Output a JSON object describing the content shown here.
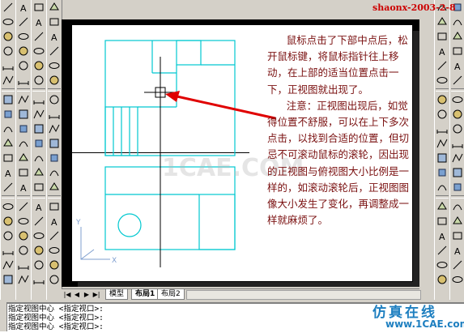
{
  "stamp": "shaonx-2003-2-8",
  "note": {
    "p1": "鼠标点击了下部中点后，松开鼠标键，将鼠标指针往上移动，在上部的适当位置点击一下，正视图就出现了。",
    "p2": "注意：正视图出现后，如觉得位置不舒服，可以在上下多次点击，以找到合适的位置，但切忌不可滚动鼠标的滚轮，因出现的正视图与俯视图大小比例是一样的，如滚动滚轮后，正视图图像大小发生了变化，再调整成一样就麻烦了。"
  },
  "ucs": {
    "x": "X",
    "y": "Y"
  },
  "tabs": {
    "model": "模型",
    "layout1": "布局1",
    "layout2": "布局2"
  },
  "command_lines": [
    "指定视图中心 <指定视口>:",
    "指定视图中心 <指定视口>:",
    "指定视图中心 <指定视口>:"
  ],
  "watermark": "1CAE.COM",
  "brand": {
    "title": "仿真在线",
    "url": "www.1CAE.com"
  },
  "colors": {
    "drawing_line": "#00c8d0",
    "note_text": "#7a1010",
    "arrow": "#e00000",
    "brand": "#1e7fc0"
  },
  "left_toolbar_icons": [
    "line-icon",
    "polyline-icon",
    "rectangle-icon",
    "circle-icon",
    "arc-icon",
    "ellipse-icon",
    "hatch-icon",
    "text-icon",
    "dimension-icon",
    "layer-icon",
    "properties-icon",
    "zoom-icon",
    "pan-icon",
    "3d-box-icon",
    "3d-sphere-icon",
    "3d-cylinder-icon",
    "3d-cone-icon",
    "3d-wedge-icon",
    "3d-torus-icon",
    "render-icon",
    "shade-icon",
    "view-icon"
  ],
  "right_toolbar_icons": [
    "line-icon",
    "construction-line-icon",
    "polyline-icon",
    "polygon-icon",
    "rectangle-icon",
    "arc-icon",
    "circle-icon",
    "revision-cloud-icon",
    "spline-icon",
    "ellipse-icon",
    "ellipse-arc-icon",
    "insert-block-icon",
    "make-block-icon",
    "point-icon",
    "hatch-icon",
    "gradient-icon",
    "region-icon",
    "table-icon",
    "multiline-text-icon"
  ]
}
